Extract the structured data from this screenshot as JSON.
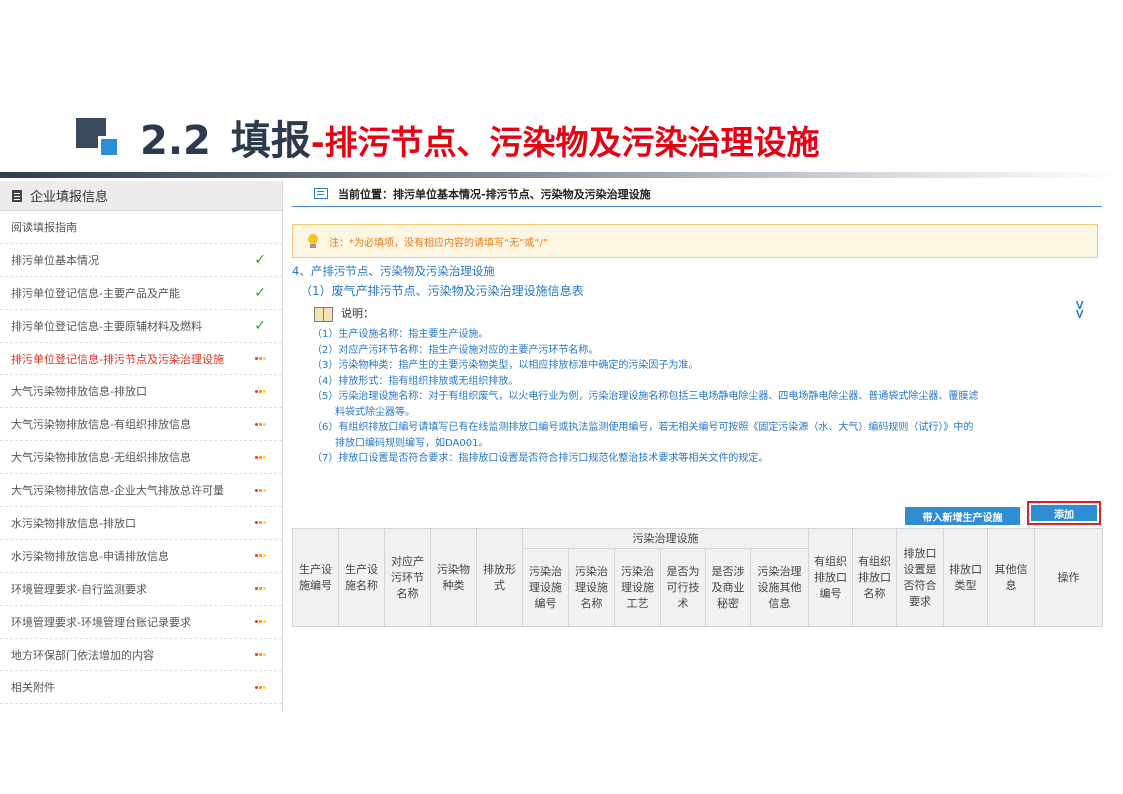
{
  "slide": {
    "section_number": "2.2",
    "title_main": "填报",
    "title_sub": "-排污节点、污染物及污染治理设施"
  },
  "sidebar": {
    "header": "企业填报信息",
    "items": [
      {
        "label": "阅读填报指南",
        "status": "none"
      },
      {
        "label": "排污单位基本情况",
        "status": "done",
        "status_icon": "check-icon",
        "status_glyph": "✓"
      },
      {
        "label": "排污单位登记信息-主要产品及产能",
        "status": "done",
        "status_icon": "check-icon",
        "status_glyph": "✓"
      },
      {
        "label": "排污单位登记信息-主要原辅材料及燃料",
        "status": "done",
        "status_icon": "check-icon",
        "status_glyph": "✓"
      },
      {
        "label": "排污单位登记信息-排污节点及污染治理设施",
        "status": "pending",
        "active": true,
        "status_icon": "status-dots-icon"
      },
      {
        "label": "大气污染物排放信息-排放口",
        "status": "pending",
        "status_icon": "status-dots-icon"
      },
      {
        "label": "大气污染物排放信息-有组织排放信息",
        "status": "pending",
        "status_icon": "status-dots-icon"
      },
      {
        "label": "大气污染物排放信息-无组织排放信息",
        "status": "pending",
        "status_icon": "status-dots-icon"
      },
      {
        "label": "大气污染物排放信息-企业大气排放总许可量",
        "status": "pending",
        "status_icon": "status-dots-icon"
      },
      {
        "label": "水污染物排放信息-排放口",
        "status": "pending",
        "status_icon": "status-dots-icon"
      },
      {
        "label": "水污染物排放信息-申请排放信息",
        "status": "pending",
        "status_icon": "status-dots-icon"
      },
      {
        "label": "环境管理要求-自行监测要求",
        "status": "pending",
        "status_icon": "status-dots-icon"
      },
      {
        "label": "环境管理要求-环境管理台账记录要求",
        "status": "pending",
        "status_icon": "status-dots-icon"
      },
      {
        "label": "地方环保部门依法增加的内容",
        "status": "pending",
        "status_icon": "status-dots-icon"
      },
      {
        "label": "相关附件",
        "status": "pending",
        "status_icon": "status-dots-icon"
      }
    ]
  },
  "main": {
    "breadcrumb": "当前位置：排污单位基本情况-排污节点、污染物及污染治理设施",
    "notice": "注：*为必填项，没有相应内容的请填写“无”或“/”",
    "section_title": "4、产排污节点、污染物及污染治理设施",
    "subsection_title": "（1）废气产排污节点、污染物及污染治理设施信息表",
    "notes_label": "说明：",
    "notes": [
      "（1）生产设施名称：指主要生产设施。",
      "（2）对应产污环节名称：指生产设施对应的主要产污环节名称。",
      "（3）污染物种类：指产生的主要污染物类型，以相应排放标准中确定的污染因子为准。",
      "（4）排放形式：指有组织排放或无组织排放。",
      "（5）污染治理设施名称：对于有组织废气，以火电行业为例，污染治理设施名称包括三电场静电除尘器、四电场静电除尘器、普通袋式除尘器、覆膜滤",
      "料袋式除尘器等。",
      "（6）有组织排放口编号请填写已有在线监测排放口编号或执法监测使用编号，若无相关编号可按照《固定污染源（水、大气）编码规则（试行）》中的",
      "排放口编码规则编写，如DA001。",
      "（7）排放口设置是否符合要求：指排放口设置是否符合排污口规范化整治技术要求等相关文件的规定。"
    ],
    "buttons": {
      "add_new_facility": "带入新增生产设施",
      "add": "添加"
    },
    "table": {
      "group_header": "污染治理设施",
      "columns_before": [
        "生产设施编号",
        "生产设施名称",
        "对应产污环节名称",
        "污染物种类",
        "排放形式"
      ],
      "group_columns": [
        "污染治理设施编号",
        "污染治理设施名称",
        "污染治理设施工艺",
        "是否为可行技术",
        "是否涉及商业秘密",
        "污染治理设施其他信息"
      ],
      "columns_after": [
        "有组织排放口编号",
        "有组织排放口名称",
        "排放口设置是否符合要求",
        "排放口类型",
        "其他信息",
        "操作"
      ]
    }
  }
}
